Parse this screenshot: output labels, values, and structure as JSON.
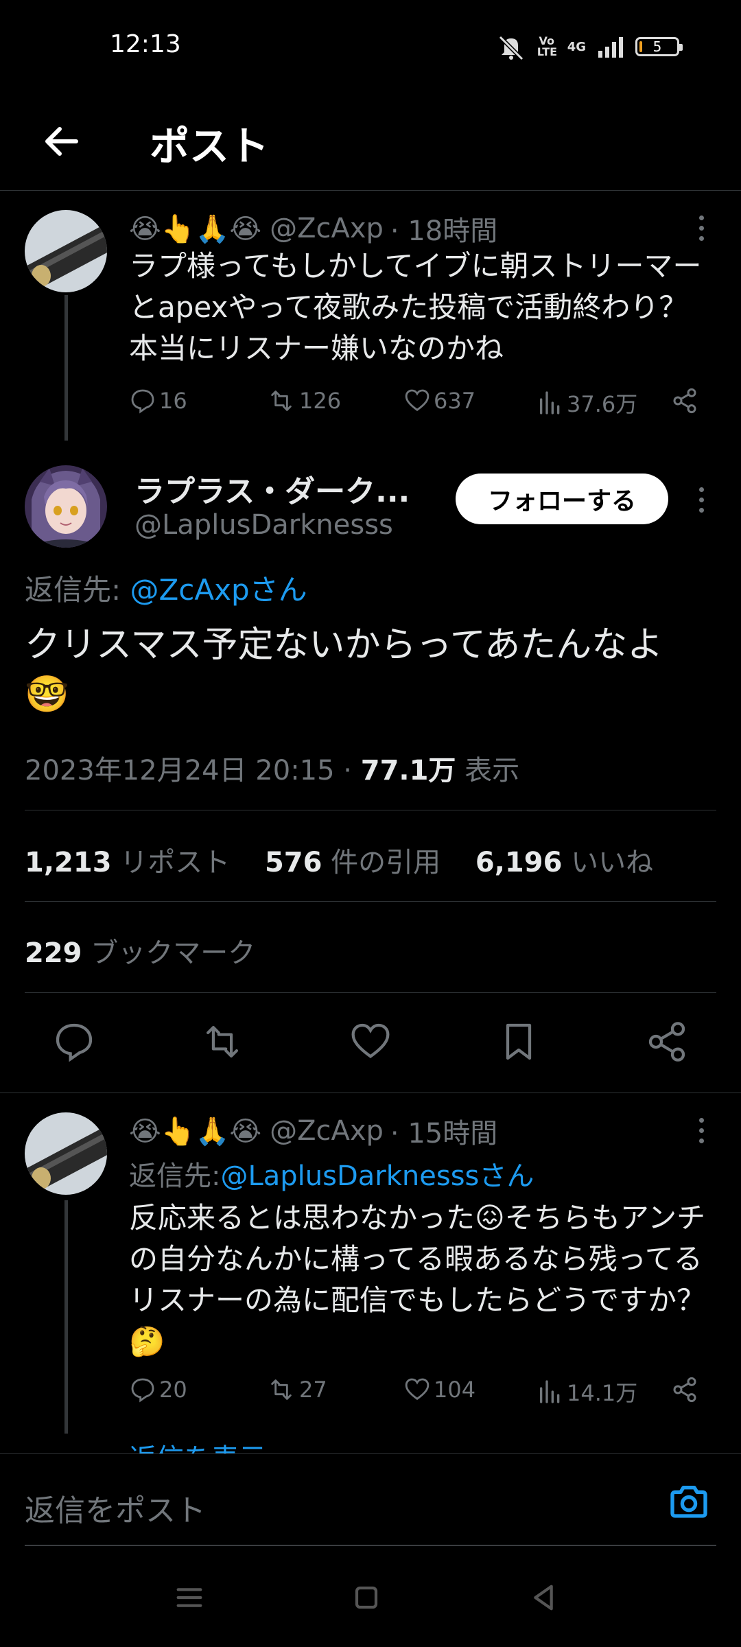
{
  "status_bar": {
    "time": "12:13",
    "battery_level": "5",
    "network": "4G",
    "volte": "Vo LTE"
  },
  "header": {
    "title": "ポスト"
  },
  "parent_post": {
    "emojis": "😭👆🙏😭",
    "handle": "@ZcAxp",
    "time": "· 18時間",
    "text": "ラプ様ってもしかしてイブに朝ストリーマーとapexやって夜歌みた投稿で活動終わり？本当にリスナー嫌いなのかね",
    "replies": "16",
    "reposts": "126",
    "likes": "637",
    "views": "37.6万"
  },
  "main_post": {
    "display_name": "ラプラス・ダーク...",
    "handle": "@LaplusDarknesss",
    "follow_label": "フォローする",
    "reply_to_prefix": "返信先: ",
    "reply_to_handle": "@ZcAxpさん",
    "text": "クリスマス予定ないからってあたんなよ",
    "text_emoji": "🤓",
    "timestamp": "2023年12月24日 20:15 · ",
    "views_count": "77.1万",
    "views_label": " 表示",
    "reposts_count": "1,213",
    "reposts_label": " リポスト",
    "quotes_count": "576",
    "quotes_label": " 件の引用",
    "likes_count": "6,196",
    "likes_label": " いいね",
    "bookmarks_count": "229",
    "bookmarks_label": " ブックマーク"
  },
  "reply_post": {
    "emojis": "😭👆🙏😭",
    "handle": "@ZcAxp",
    "time": "· 15時間",
    "reply_to_prefix": "返信先: ",
    "reply_to_handle": "@LaplusDarknesssさん",
    "text_part1": "反応来るとは思わなかった",
    "emoji1": "😖",
    "text_part2": "そちらもアンチの自分なんかに構ってる暇あるなら残ってるリスナーの為に配信でもしたらどうですか？",
    "emoji2": "🤔",
    "replies": "20",
    "reposts": "27",
    "likes": "104",
    "views": "14.1万",
    "show_replies": "返信を表示"
  },
  "reply_bar": {
    "placeholder": "返信をポスト"
  }
}
